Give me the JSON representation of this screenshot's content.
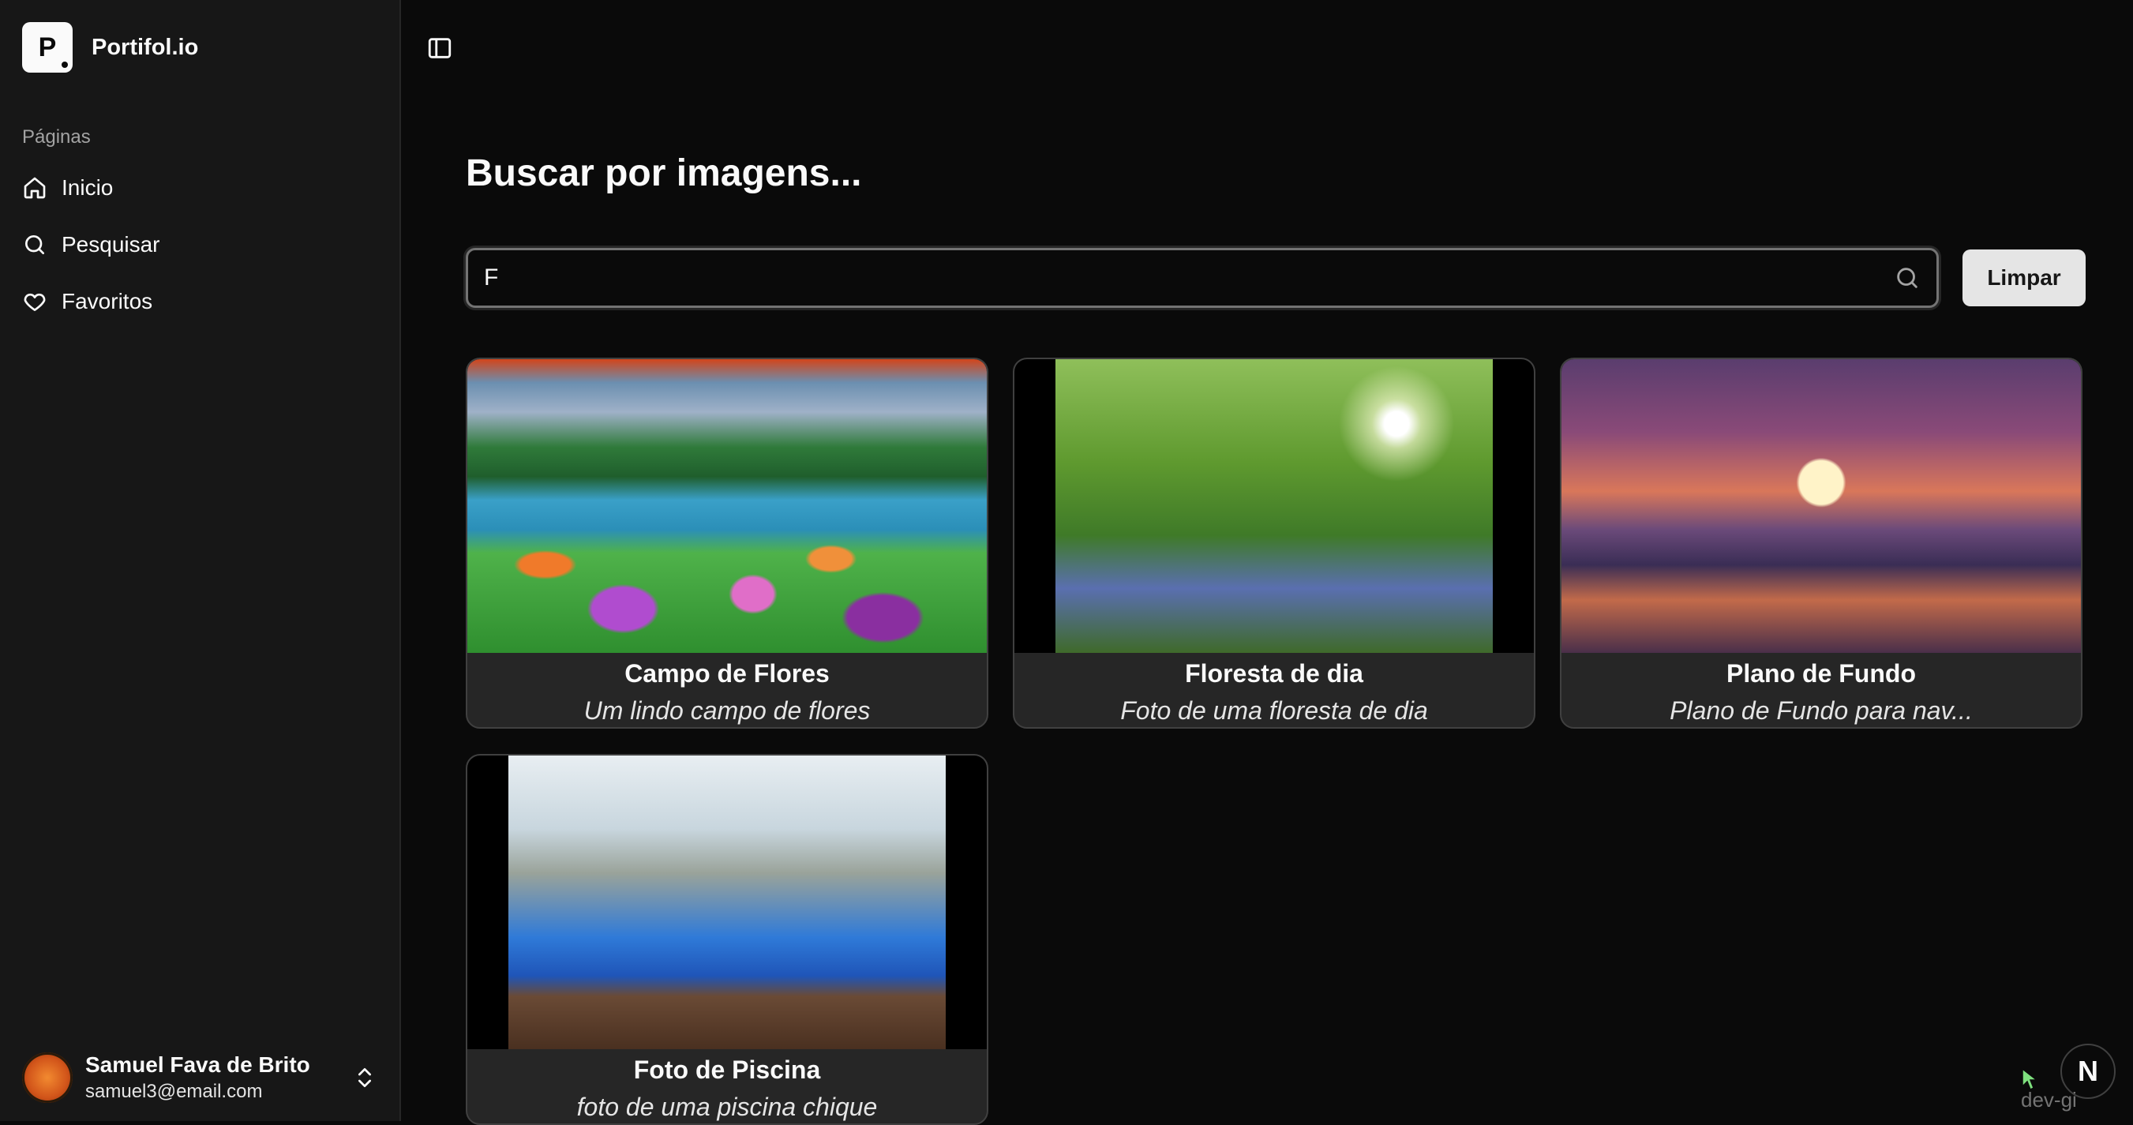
{
  "app": {
    "name": "Portifol.io",
    "logo_letter": "P"
  },
  "sidebar": {
    "section_label": "Páginas",
    "items": [
      {
        "label": "Inicio",
        "icon": "home-icon"
      },
      {
        "label": "Pesquisar",
        "icon": "search-icon"
      },
      {
        "label": "Favoritos",
        "icon": "heart-icon"
      }
    ]
  },
  "user": {
    "name": "Samuel Fava de Brito",
    "email": "samuel3@email.com"
  },
  "main": {
    "title": "Buscar por imagens...",
    "search": {
      "value": "F",
      "placeholder": ""
    },
    "clear_label": "Limpar",
    "cards": [
      {
        "title": "Campo de Flores",
        "description": "Um lindo campo de flores"
      },
      {
        "title": "Floresta de dia",
        "description": "Foto de uma floresta de dia"
      },
      {
        "title": "Plano de Fundo",
        "description": "Plano de Fundo para nav..."
      },
      {
        "title": "Foto de Piscina",
        "description": "foto de uma piscina chique"
      }
    ]
  },
  "overlay": {
    "fab_letter": "N",
    "watermark": "dev-gi"
  },
  "colors": {
    "background": "#0a0a0a",
    "sidebar": "#171717",
    "card": "#262626",
    "accent_button": "#e5e5e5"
  }
}
